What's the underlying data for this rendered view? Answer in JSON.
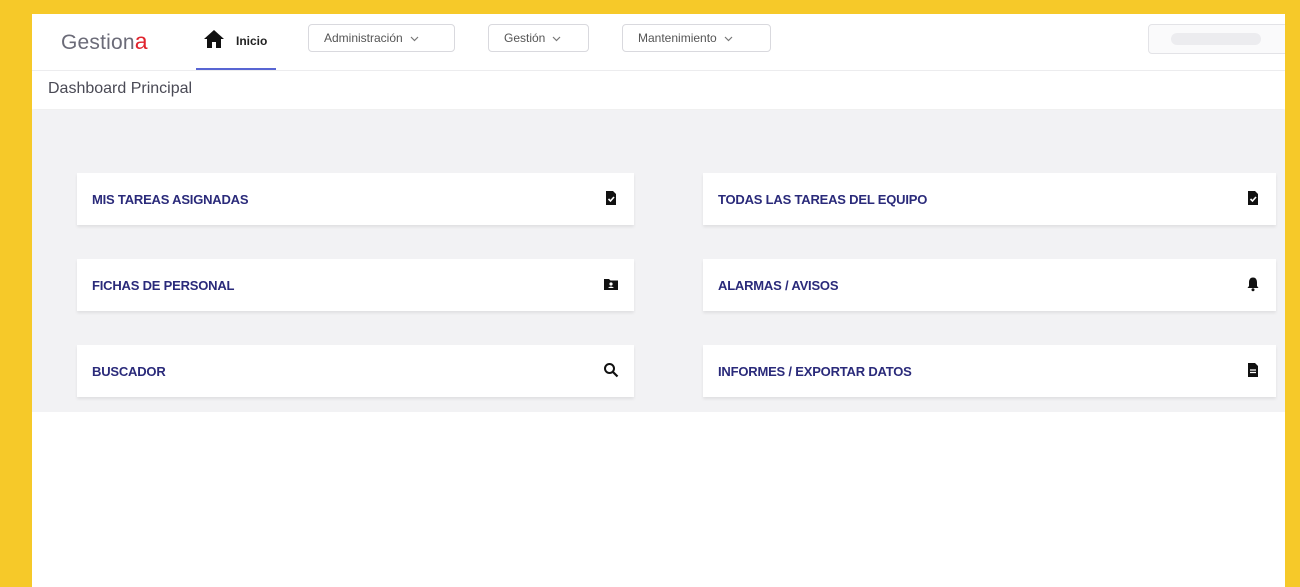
{
  "header": {
    "logo_text": "Gestion",
    "logo_accent": "a",
    "home_label": "Inicio",
    "menus": [
      "Administración",
      "Gestión",
      "Mantenimiento"
    ]
  },
  "page": {
    "title": "Dashboard Principal"
  },
  "cards": [
    {
      "label": "MIS TAREAS ASIGNADAS",
      "icon": "task-check-icon"
    },
    {
      "label": "TODAS LAS TAREAS DEL EQUIPO",
      "icon": "task-check-icon"
    },
    {
      "label": "FICHAS DE PERSONAL",
      "icon": "folder-user-icon"
    },
    {
      "label": "ALARMAS / AVISOS",
      "icon": "bell-icon"
    },
    {
      "label": "BUSCADOR",
      "icon": "search-icon"
    },
    {
      "label": "INFORMES / EXPORTAR DATOS",
      "icon": "document-icon"
    }
  ],
  "colors": {
    "frame": "#f6c929",
    "logo_accent": "#e0232d",
    "active_tab": "#5865d3",
    "card_text": "#2a2a7a",
    "content_bg": "#f2f2f4"
  }
}
